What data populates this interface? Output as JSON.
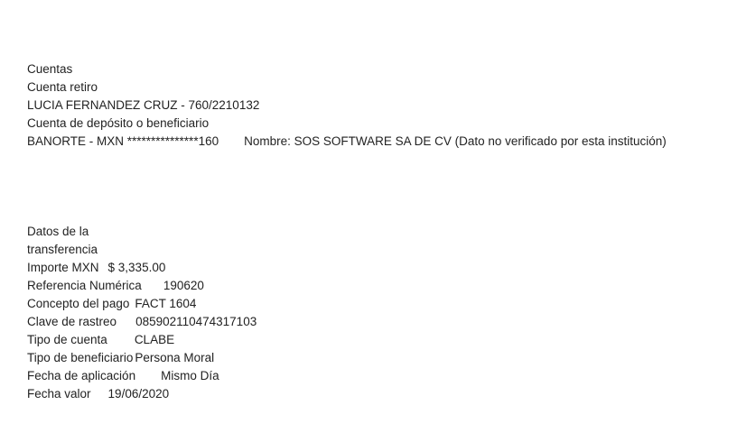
{
  "cuentas": {
    "heading": "Cuentas",
    "retiro_label": "Cuenta retiro",
    "retiro_value": "LUCIA FERNANDEZ CRUZ - 760/2210132",
    "deposito_label": "Cuenta de depósito o beneficiario",
    "deposito_account": "BANORTE - MXN ***************160",
    "deposito_name": "Nombre: SOS SOFTWARE SA DE CV (Dato no verificado por esta institución)"
  },
  "transferencia": {
    "heading_line1": "Datos de la",
    "heading_line2": "transferencia",
    "rows": [
      {
        "label": "Importe MXN",
        "value": "$ 3,335.00"
      },
      {
        "label": "Referencia Numérica",
        "value": "190620"
      },
      {
        "label": "Concepto del pago",
        "value": "FACT 1604"
      },
      {
        "label": "Clave de rastreo",
        "value": "085902110474317103"
      },
      {
        "label": "Tipo de cuenta",
        "value": "CLABE"
      },
      {
        "label": "Tipo de beneficiario",
        "value": "Persona Moral"
      },
      {
        "label": "Fecha de aplicación",
        "value": "Mismo Día"
      },
      {
        "label": "Fecha valor",
        "value": "19/06/2020"
      }
    ]
  }
}
